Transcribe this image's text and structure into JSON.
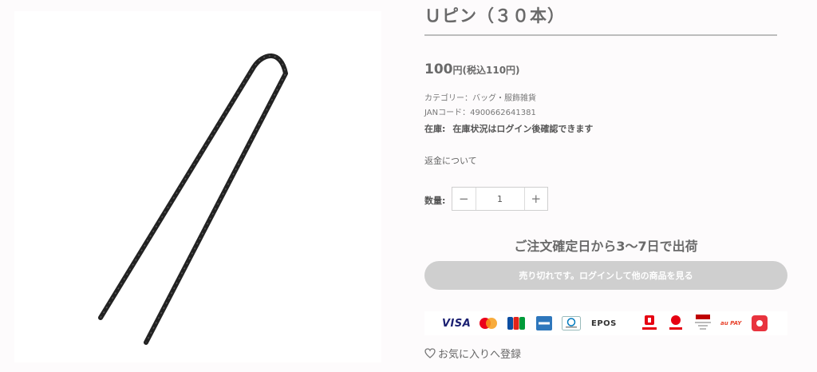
{
  "product": {
    "title": "Ｕピン（３０本）",
    "image_alt": "Uピン 黒 画像",
    "price": {
      "amount": "100",
      "yen": "円",
      "tax_note": "(税込110円)"
    },
    "category_line": "カテゴリー：バッグ・服飾雑貨",
    "jan_line": "JANコード：4900662641381",
    "stock": {
      "label": "在庫:",
      "value": "在庫状況はログイン後確認できます"
    },
    "refund_link": "返金について",
    "quantity": {
      "label": "数量:",
      "minus": "−",
      "plus": "+",
      "value": "1"
    },
    "shipping_note": "ご注文確定日から3〜7日で出荷",
    "soldout_button": "売り切れです。ログインして他の商品を見る",
    "favorite": "お気に入りへ登録"
  },
  "payment_methods": [
    "VISA",
    "Mastercard",
    "JCB",
    "American Express",
    "Diners Club",
    "EPOS",
    "PayPay",
    "d払い",
    "R Pay",
    "au PAY",
    "メルペイ"
  ],
  "colors": {
    "accent_gray": "#cfcfcf",
    "paypay_red": "#e60012",
    "visa_blue": "#1a1f71"
  }
}
